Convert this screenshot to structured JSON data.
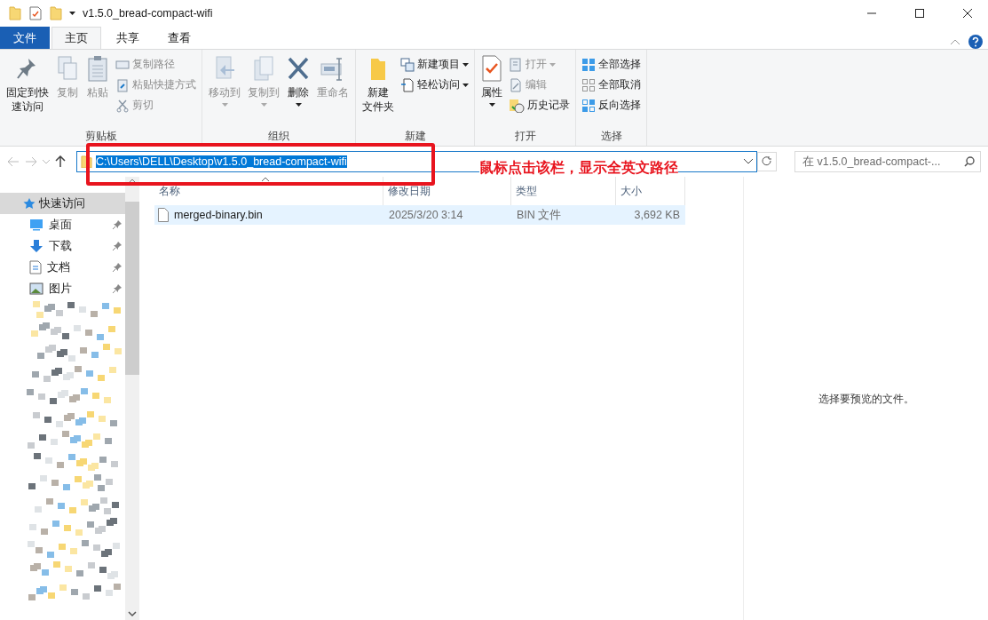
{
  "title_bar": {
    "title": "v1.5.0_bread-compact-wifi"
  },
  "ribbon_tabs": [
    {
      "label": "文件",
      "kind": "file",
      "selected": false
    },
    {
      "label": "主页",
      "kind": "tab",
      "selected": true
    },
    {
      "label": "共享",
      "kind": "tab",
      "selected": false
    },
    {
      "label": "查看",
      "kind": "tab",
      "selected": false
    }
  ],
  "ribbon_groups": [
    {
      "label": "剪贴板",
      "items": [
        {
          "label": [
            "固定到快",
            "速访问"
          ],
          "kind": "large",
          "disabled": false
        },
        {
          "label": "复制",
          "kind": "large",
          "disabled": true
        },
        {
          "label": "粘贴",
          "kind": "large",
          "disabled": true
        },
        {
          "label": "复制路径",
          "kind": "small",
          "disabled": true
        },
        {
          "label": "粘贴快捷方式",
          "kind": "small",
          "disabled": true
        },
        {
          "label": "剪切",
          "kind": "small",
          "disabled": true
        }
      ]
    },
    {
      "label": "组织",
      "items": [
        {
          "label": "移动到",
          "kind": "large",
          "disabled": true,
          "dropdown": true
        },
        {
          "label": "复制到",
          "kind": "large",
          "disabled": true,
          "dropdown": true
        },
        {
          "label": "删除",
          "kind": "large",
          "disabled": false,
          "dropdown": true
        },
        {
          "label": "重命名",
          "kind": "large",
          "disabled": true
        }
      ]
    },
    {
      "label": "新建",
      "items": [
        {
          "label": [
            "新建",
            "文件夹"
          ],
          "kind": "large",
          "disabled": false
        },
        {
          "label": "新建项目",
          "kind": "small",
          "disabled": false,
          "dropdown": true
        },
        {
          "label": "轻松访问",
          "kind": "small",
          "disabled": false,
          "dropdown": true
        }
      ]
    },
    {
      "label": "打开",
      "items": [
        {
          "label": "属性",
          "kind": "large",
          "disabled": false,
          "dropdown": true
        },
        {
          "label": "打开",
          "kind": "small",
          "disabled": true,
          "dropdown": true
        },
        {
          "label": "编辑",
          "kind": "small",
          "disabled": true
        },
        {
          "label": "历史记录",
          "kind": "small",
          "disabled": false
        }
      ]
    },
    {
      "label": "选择",
      "items": [
        {
          "label": "全部选择",
          "kind": "small",
          "disabled": false
        },
        {
          "label": "全部取消",
          "kind": "small",
          "disabled": false
        },
        {
          "label": "反向选择",
          "kind": "small",
          "disabled": false
        }
      ]
    }
  ],
  "address_bar": {
    "path": "C:\\Users\\DELL\\Desktop\\v1.5.0_bread-compact-wifi",
    "selected": true
  },
  "search": {
    "placeholder": "在 v1.5.0_bread-compact-..."
  },
  "annotation": {
    "text": "鼠标点击该栏，显示全英文路径"
  },
  "navigation": {
    "header": {
      "label": "快速访问",
      "selected": true
    },
    "items": [
      {
        "label": "桌面",
        "pinned": true
      },
      {
        "label": "下载",
        "pinned": true
      },
      {
        "label": "文档",
        "pinned": true
      },
      {
        "label": "图片",
        "pinned": true
      }
    ]
  },
  "file_list": {
    "columns": [
      {
        "label": "名称",
        "sorted": true
      },
      {
        "label": "修改日期",
        "sorted": false
      },
      {
        "label": "类型",
        "sorted": false
      },
      {
        "label": "大小",
        "sorted": false
      }
    ],
    "rows": [
      {
        "name": "merged-binary.bin",
        "date": "2025/3/20 3:14",
        "type": "BIN 文件",
        "size": "3,692 KB",
        "selected": true
      }
    ]
  },
  "preview": {
    "message": "选择要预览的文件。"
  }
}
